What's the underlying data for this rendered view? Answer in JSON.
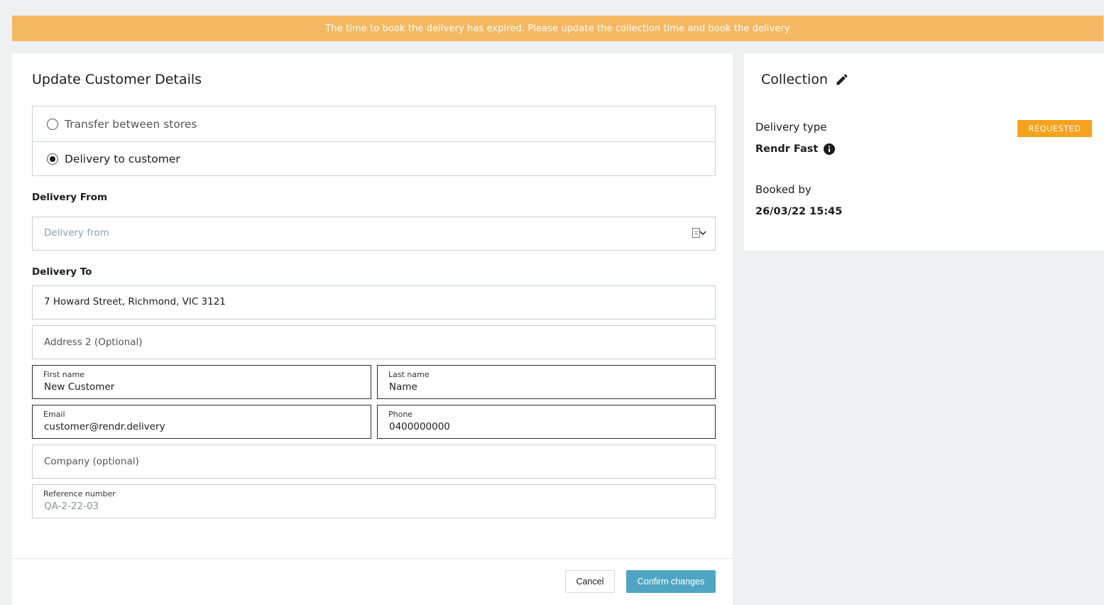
{
  "banner": {
    "message": "The time to book the delivery has expired. Please update the collection time and book the delivery"
  },
  "form": {
    "title": "Update Customer Details",
    "delivery_options": [
      {
        "label": "Transfer between stores",
        "selected": false
      },
      {
        "label": "Delivery to customer",
        "selected": true
      }
    ],
    "delivery_from": {
      "section_label": "Delivery From",
      "placeholder": "Delivery from",
      "icon": "document-icon"
    },
    "delivery_to": {
      "section_label": "Delivery To",
      "address1": "7 Howard Street, Richmond, VIC 3121",
      "address2_placeholder": "Address 2 (Optional)",
      "first_name": {
        "label": "First name",
        "value": "New Customer"
      },
      "last_name": {
        "label": "Last name",
        "value": "Name"
      },
      "email": {
        "label": "Email",
        "value": "customer@rendr.delivery"
      },
      "phone": {
        "label": "Phone",
        "value": "0400000000"
      },
      "company_placeholder": "Company (optional)",
      "reference": {
        "label": "Reference number",
        "value": "QA-2-22-03"
      }
    },
    "buttons": {
      "cancel": "Cancel",
      "confirm": "Confirm changes"
    }
  },
  "collection": {
    "title": "Collection",
    "edit_icon": "pencil-icon",
    "delivery_type_label": "Delivery type",
    "delivery_type_value": "Rendr Fast",
    "info_icon": "info-icon",
    "status_badge": "REQUESTED",
    "booked_by_label": "Booked by",
    "booked_by_value": "26/03/22 15:45"
  },
  "colors": {
    "banner_bg": "#f5b862",
    "badge_bg": "#f7a21c",
    "confirm_button_bg": "#4ea6c2"
  }
}
